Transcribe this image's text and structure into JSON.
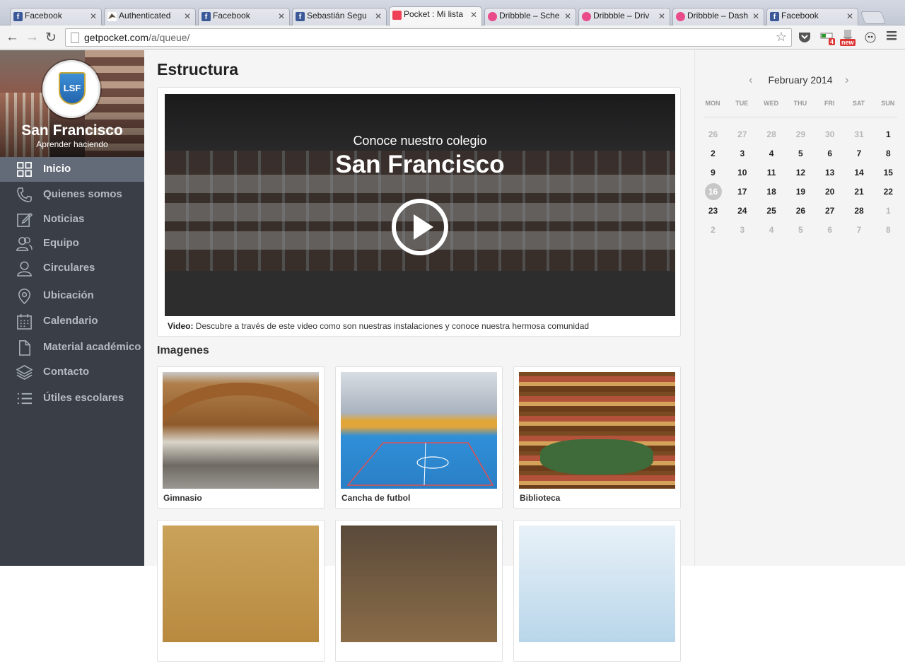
{
  "browser": {
    "tabs": [
      {
        "title": "Facebook",
        "icon": "facebook-icon"
      },
      {
        "title": "Authenticated",
        "icon": "authenticated-icon"
      },
      {
        "title": "Facebook",
        "icon": "facebook-icon"
      },
      {
        "title": "Sebastián Segu",
        "icon": "facebook-icon"
      },
      {
        "title": "Pocket : Mi lista",
        "icon": "pocket-icon"
      },
      {
        "title": "Dribbble – Sche",
        "icon": "dribbble-icon"
      },
      {
        "title": "Dribbble – Driv",
        "icon": "dribbble-icon"
      },
      {
        "title": "Dribbble – Dash",
        "icon": "dribbble-icon"
      },
      {
        "title": "Facebook",
        "icon": "facebook-icon"
      }
    ],
    "url_domain": "getpocket.com",
    "url_path": "/a/queue/",
    "ext_badge_count": "4",
    "ext_badge_new": "new"
  },
  "sidebar": {
    "school_name": "San Francisco",
    "tagline": "Aprender haciendo",
    "logo_text": "LSF",
    "items": [
      {
        "label": "Inicio",
        "icon": "grid-icon"
      },
      {
        "label": "Quienes somos",
        "icon": "phone-icon"
      },
      {
        "label": "Noticias",
        "icon": "edit-icon"
      },
      {
        "label": "Equipo",
        "icon": "users-icon"
      },
      {
        "label": "Circulares",
        "icon": "user-icon"
      },
      {
        "label": "Ubicación",
        "icon": "location-pin-icon"
      },
      {
        "label": "Calendario",
        "icon": "calendar-icon"
      },
      {
        "label": "Material académico",
        "icon": "document-icon"
      },
      {
        "label": "Contacto",
        "icon": "layers-icon"
      },
      {
        "label": "Útiles escolares",
        "icon": "list-icon"
      }
    ]
  },
  "main": {
    "title": "Estructura",
    "video": {
      "kicker": "Conoce nuestro colegio",
      "title": "San Francisco",
      "caption_label": "Video:",
      "caption_text": "Descubre a través de este video como son nuestras instalaciones y conoce nuestra hermosa comunidad"
    },
    "images_heading": "Imagenes",
    "images": [
      {
        "caption": "Gimnasio"
      },
      {
        "caption": "Cancha de futbol"
      },
      {
        "caption": "Biblioteca"
      }
    ]
  },
  "calendar": {
    "month_label": "February 2014",
    "weekdays": [
      "MON",
      "TUE",
      "WED",
      "THU",
      "FRI",
      "SAT",
      "SUN"
    ],
    "weeks": [
      [
        26,
        27,
        28,
        29,
        30,
        31,
        1
      ],
      [
        2,
        3,
        4,
        5,
        6,
        7,
        8
      ],
      [
        9,
        10,
        11,
        12,
        13,
        14,
        15
      ],
      [
        16,
        17,
        18,
        19,
        20,
        21,
        22
      ],
      [
        23,
        24,
        25,
        26,
        27,
        28,
        1
      ],
      [
        2,
        3,
        4,
        5,
        6,
        7,
        8
      ]
    ],
    "today": 16
  },
  "colors": {
    "sidebar_bg": "#3a3f47",
    "sidebar_active": "#636b78",
    "accent_pocket": "#ee4056"
  }
}
